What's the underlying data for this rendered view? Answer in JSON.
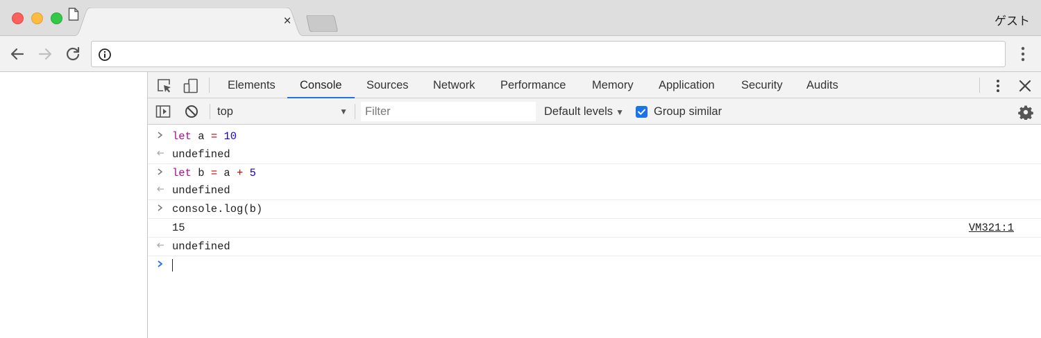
{
  "window": {
    "profile_label": "ゲスト"
  },
  "tab": {
    "close_glyph": "×"
  },
  "toolbar": {
    "url": "",
    "icons": [
      "back-arrow-icon",
      "forward-arrow-icon",
      "reload-icon",
      "info-icon",
      "menu-dots-icon"
    ]
  },
  "devtools": {
    "tabs": [
      {
        "label": "Elements"
      },
      {
        "label": "Console"
      },
      {
        "label": "Sources"
      },
      {
        "label": "Network"
      },
      {
        "label": "Performance"
      },
      {
        "label": "Memory"
      },
      {
        "label": "Application"
      },
      {
        "label": "Security"
      },
      {
        "label": "Audits"
      }
    ],
    "active_tab": "Console",
    "console_bar": {
      "context": "top",
      "filter_placeholder": "Filter",
      "levels": "Default levels",
      "group_similar_label": "Group similar",
      "group_similar_checked": true
    }
  },
  "console": {
    "lines": [
      {
        "type": "input",
        "tokens": [
          "let",
          " a ",
          "=",
          " ",
          "10"
        ]
      },
      {
        "type": "result",
        "text": "undefined"
      },
      {
        "type": "input",
        "tokens": [
          "let",
          " b ",
          "=",
          " a ",
          "+",
          " ",
          "5"
        ]
      },
      {
        "type": "result",
        "text": "undefined"
      },
      {
        "type": "input",
        "text": "console.log(b)"
      },
      {
        "type": "log",
        "text": "15",
        "source": "VM321:1"
      },
      {
        "type": "result",
        "text": "undefined"
      },
      {
        "type": "prompt",
        "text": ""
      }
    ]
  },
  "colors": {
    "keyword": "#aa0d91",
    "number": "#1c00cf",
    "operator": "#c80000",
    "accent": "#1a73e8"
  }
}
